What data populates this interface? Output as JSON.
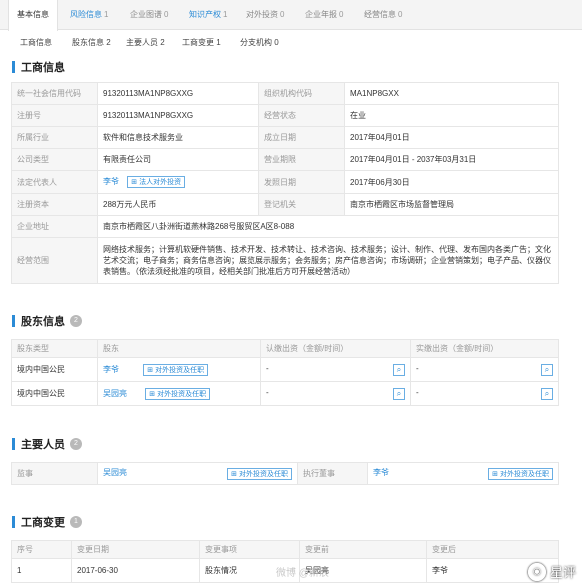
{
  "top_tabs": [
    {
      "label": "基本信息",
      "count": ""
    },
    {
      "label": "风险信息",
      "count": "1"
    },
    {
      "label": "企业图谱",
      "count": "0"
    },
    {
      "label": "知识产权",
      "count": "1"
    },
    {
      "label": "对外投资",
      "count": "0"
    },
    {
      "label": "企业年报",
      "count": "0"
    },
    {
      "label": "经营信息",
      "count": "0"
    }
  ],
  "sub_tabs": [
    {
      "label": "工商信息",
      "count": ""
    },
    {
      "label": "股东信息",
      "count": "2"
    },
    {
      "label": "主要人员",
      "count": "2"
    },
    {
      "label": "工商变更",
      "count": "1"
    },
    {
      "label": "分支机构",
      "count": "0"
    }
  ],
  "business_info": {
    "title": "工商信息",
    "rows": [
      {
        "k1": "统一社会信用代码",
        "v1": "91320113MA1NP8GXXG",
        "k2": "组织机构代码",
        "v2": "MA1NP8GXX"
      },
      {
        "k1": "注册号",
        "v1": "91320113MA1NP8GXXG",
        "k2": "经营状态",
        "v2": "在业"
      },
      {
        "k1": "所属行业",
        "v1": "软件和信息技术服务业",
        "k2": "成立日期",
        "v2": "2017年04月01日"
      },
      {
        "k1": "公司类型",
        "v1": "有限责任公司",
        "k2": "营业期限",
        "v2": "2017年04月01日 - 2037年03月31日"
      },
      {
        "k1": "法定代表人",
        "v1": "李爷",
        "k2": "发照日期",
        "v2": "2017年06月30日"
      },
      {
        "k1": "注册资本",
        "v1": "288万元人民币",
        "k2": "登记机关",
        "v2": "南京市栖霞区市场监督管理局"
      }
    ],
    "legal_rep_button": "法人对外投资",
    "address_label": "企业地址",
    "address": "南京市栖霞区八卦洲街道燕林路268号服贸区A区8-088",
    "scope_label": "经营范围",
    "scope": "网络技术服务；计算机软硬件销售、技术开发、技术转让、技术咨询、技术服务；设计、制作、代理、发布国内各类广告；文化艺术交流；电子商务；商务信息咨询；展览展示服务；会务服务；房产信息咨询；市场调研；企业营销策划；电子产品、仪器仪表销售。（依法须经批准的项目，经相关部门批准后方可开展经营活动）"
  },
  "shareholders": {
    "title": "股东信息",
    "badge": "2",
    "headers": [
      "股东类型",
      "股东",
      "认缴出资（金额/时间）",
      "实缴出资（金额/时间）"
    ],
    "button_label": "对外投资及任职",
    "rows": [
      {
        "type": "境内中国公民",
        "name": "李爷",
        "subscribed": "-",
        "paid": "-"
      },
      {
        "type": "境内中国公民",
        "name": "吴园亮",
        "subscribed": "-",
        "paid": "-"
      }
    ]
  },
  "key_personnel": {
    "title": "主要人员",
    "badge": "2",
    "button_label": "对外投资及任职",
    "rows": [
      {
        "role1": "监事",
        "name1": "吴园亮",
        "role2": "执行董事",
        "name2": "李爷"
      }
    ]
  },
  "changes": {
    "title": "工商变更",
    "badge": "1",
    "headers": [
      "序号",
      "变更日期",
      "变更事项",
      "变更前",
      "变更后"
    ],
    "rows": [
      {
        "no": "1",
        "date": "2017-06-30",
        "item": "股东情况",
        "before": "吴园亮",
        "after": "李爷"
      }
    ]
  },
  "watermark": {
    "text": "星评",
    "mid": "微博 @新浪"
  },
  "colors": {
    "accent": "#2b8bd6",
    "badge": "#b9b9b9"
  }
}
